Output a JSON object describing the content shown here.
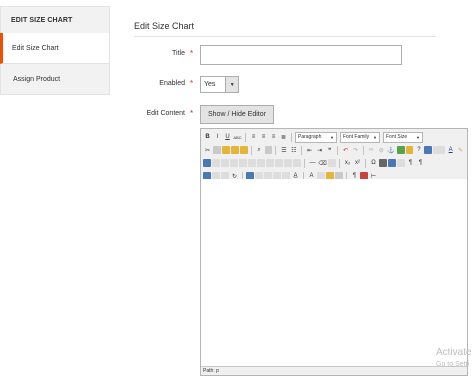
{
  "sidebar": {
    "heading": "EDIT SIZE CHART",
    "items": [
      {
        "label": "Edit Size Chart",
        "active": true
      },
      {
        "label": "Assign Product",
        "active": false
      }
    ]
  },
  "main": {
    "title": "Edit Size Chart",
    "fields": {
      "title": {
        "label": "Title",
        "value": ""
      },
      "enabled": {
        "label": "Enabled",
        "value": "Yes"
      },
      "content": {
        "label": "Edit Content",
        "button": "Show / Hide Editor"
      }
    }
  },
  "editor": {
    "format_dropdowns": [
      "Paragraph",
      "Font Family",
      "Font Size"
    ],
    "path": "Path: p"
  },
  "watermark": {
    "line1": "Activate",
    "line2": "Go to Setti"
  },
  "colors": {
    "accent": "#eb5202",
    "required": "#e22626"
  }
}
